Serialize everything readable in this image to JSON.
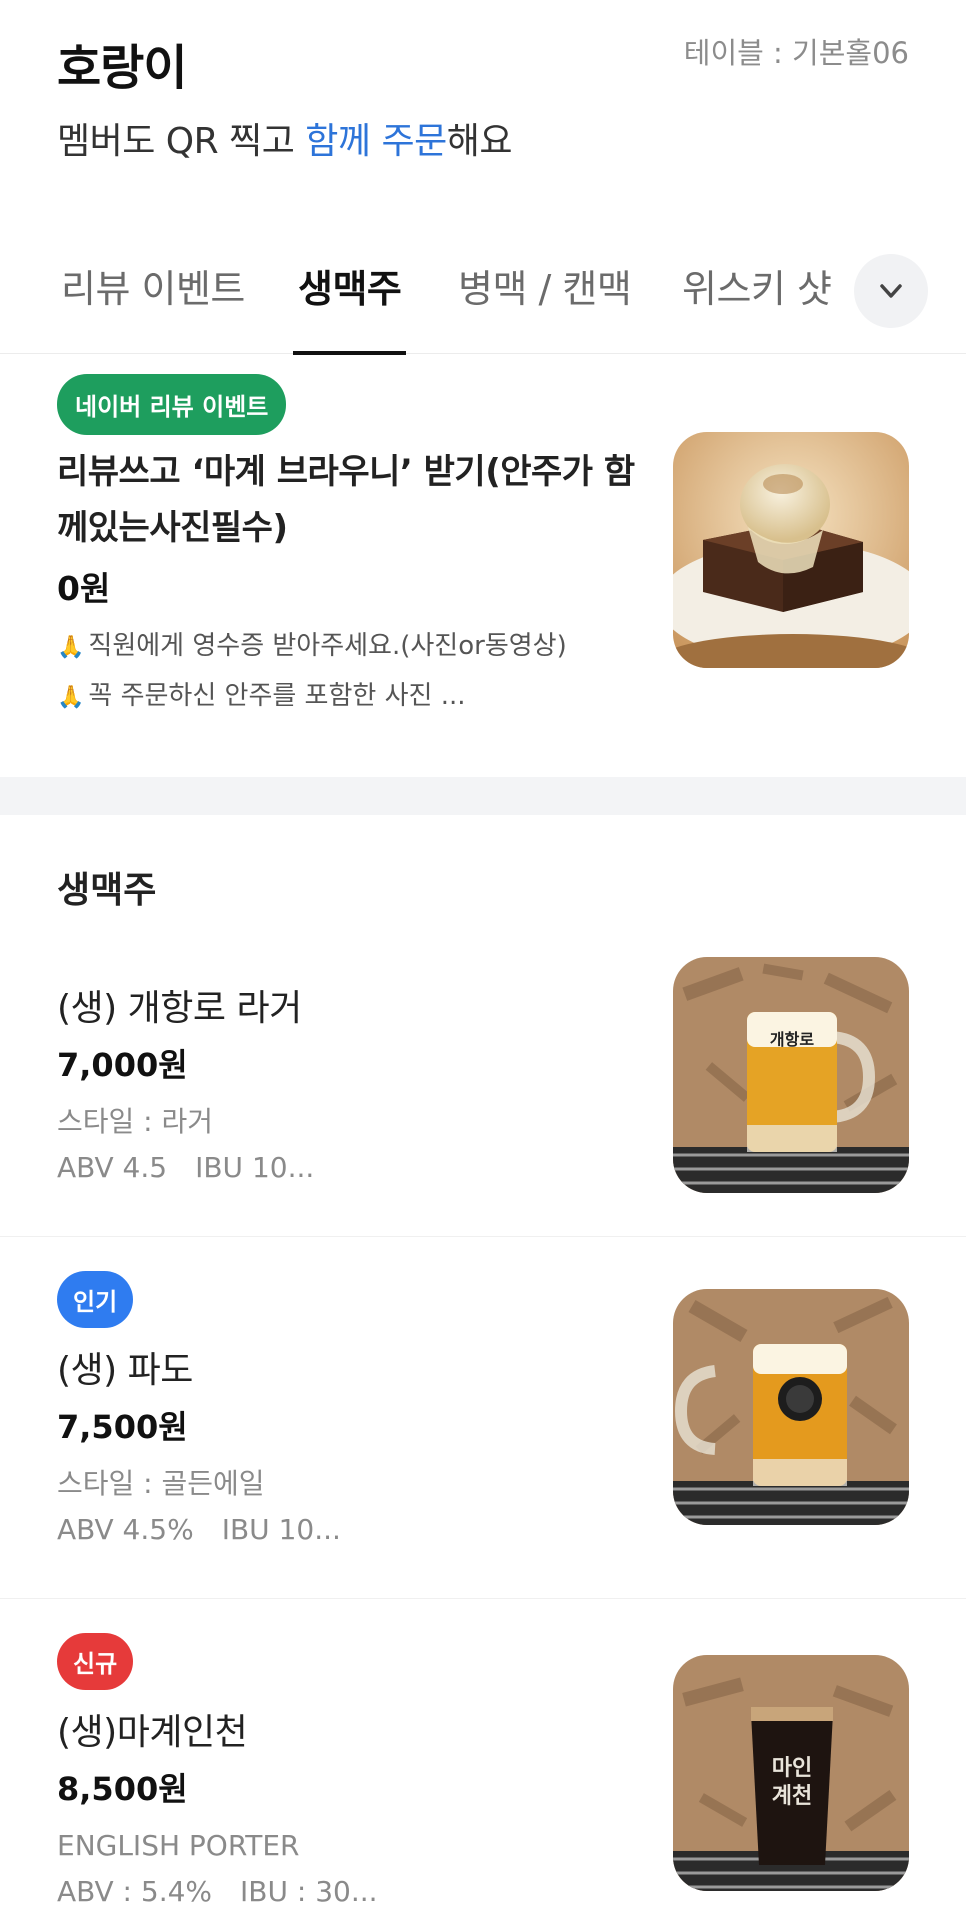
{
  "header": {
    "store_name": "호랑이",
    "table_label": "테이블 : 기본홀06",
    "subtitle_pre": "멤버도 QR 찍고 ",
    "subtitle_accent": "함께 주문",
    "subtitle_post": "해요"
  },
  "tabs": [
    {
      "label": "리뷰 이벤트",
      "active": false
    },
    {
      "label": "생맥주",
      "active": true
    },
    {
      "label": "병맥 / 캔맥",
      "active": false
    },
    {
      "label": "위스키 샷",
      "active": false
    }
  ],
  "event": {
    "badge": "네이버 리뷰 이벤트",
    "title": "리뷰쓰고 ‘마계 브라우니’ 받기(안주가 함께있는사진필수)",
    "price": "0원",
    "desc_1": "직원에게 영수증 받아주세요.(사진or동영상)",
    "desc_2": "꼭 주문하신 안주를 포함한 사진 ..."
  },
  "section": {
    "title": "생맥주"
  },
  "items": [
    {
      "badge": "",
      "name": "(생) 개항로 라거",
      "price": "7,000원",
      "info_1": "스타일 : 라거",
      "info_2a": "ABV 4.5",
      "info_2b": "IBU 10..."
    },
    {
      "badge": "인기",
      "name": "(생) 파도",
      "price": "7,500원",
      "info_1": "스타일 : 골든에일",
      "info_2a": "ABV 4.5%",
      "info_2b": "IBU 10..."
    },
    {
      "badge": "신규",
      "name": "(생)마계인천",
      "price": "8,500원",
      "info_1": "ENGLISH PORTER",
      "info_2a": "ABV : 5.4%",
      "info_2b": "IBU : 30..."
    }
  ],
  "colors": {
    "accent": "#2d74d9",
    "event_badge": "#1e9e5e",
    "popular_badge": "#2f7cf0",
    "new_badge": "#e63a3a"
  },
  "icons": {
    "tabs_more": "chevron-down-icon",
    "event_bullet": "folded-hands-icon"
  }
}
